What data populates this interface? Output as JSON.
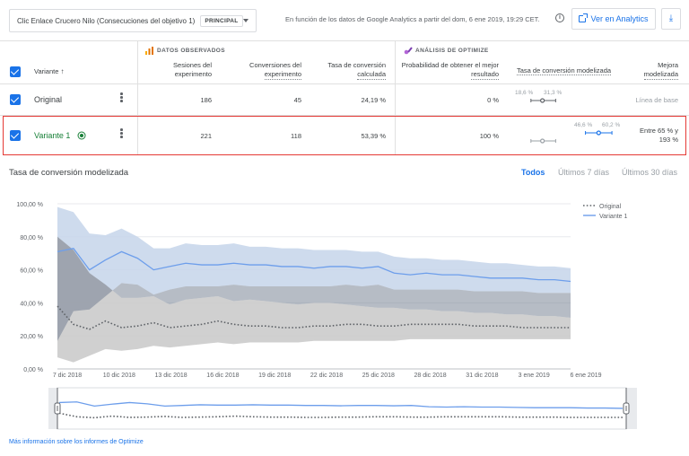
{
  "header": {
    "objective_selector": "Clic Enlace Crucero Nilo (Consecuciones del objetivo 1)",
    "principal_badge": "PRINCIPAL",
    "ga_info": "En función de los datos de Google Analytics a partir del dom, 6 ene 2019, 19:29 CET.",
    "info_icon_glyph": "i",
    "analytics_button": "Ver en Analytics",
    "download_glyph": "⤓"
  },
  "table": {
    "group_observed": "DATOS OBSERVADOS",
    "group_optimize": "ANÁLISIS DE OPTIMIZE",
    "col_variant": "Variante",
    "col_sessions": [
      "Sesiones del",
      "experimento"
    ],
    "col_conversions": [
      "Conversiones del",
      "experimento"
    ],
    "col_rate": [
      "Tasa de conversión",
      "calculada"
    ],
    "col_probability": [
      "Probabilidad de obtener el mejor",
      "resultado"
    ],
    "col_modeled": "Tasa de conversión modelizada",
    "col_improvement": [
      "Mejora",
      "modelizada"
    ],
    "rows": [
      {
        "name": "Original",
        "sessions": "186",
        "conversions": "45",
        "rate": "24,19 %",
        "probability": "0 %",
        "ci_low": "18,6 %",
        "ci_high": "31,3 %",
        "improvement": "Línea de base",
        "ci_low_value": 18.6,
        "ci_high_value": 31.3,
        "ci_mid_value": 24.5
      },
      {
        "name": "Variante 1",
        "sessions": "221",
        "conversions": "118",
        "rate": "53,39 %",
        "probability": "100 %",
        "ci_low": "46,6 %",
        "ci_high": "60,2 %",
        "improvement": [
          "Entre 65 % y",
          "193 %"
        ],
        "ci_low_value": 46.6,
        "ci_high_value": 60.2,
        "ci_mid_value": 53.4
      }
    ]
  },
  "chart": {
    "title": "Tasa de conversión modelizada",
    "ranges": [
      "Todos",
      "Últimos 7 días",
      "Últimos 30 días"
    ],
    "active_range": "Todos",
    "footer_link": "Más información sobre los informes de Optimize",
    "colors": {
      "variant": "#6d9eeb",
      "variant_band": "#c6d5ea",
      "original": "#5f6368",
      "original_band": "#c8c8c8",
      "accent": "#1a73e8",
      "selected_border": "#e53935"
    }
  },
  "chart_data": {
    "type": "line",
    "title": "Tasa de conversión modelizada",
    "ylim": [
      0,
      100
    ],
    "yticks": [
      "0,00 %",
      "20,00 %",
      "40,00 %",
      "60,00 %",
      "80,00 %",
      "100,00 %"
    ],
    "xticks": [
      "7 dic 2018",
      "10 dic 2018",
      "13 dic 2018",
      "16 dic 2018",
      "19 dic 2018",
      "22 dic 2018",
      "25 dic 2018",
      "28 dic 2018",
      "31 dic 2018",
      "3 ene 2019",
      "6 ene 2019"
    ],
    "legend_position": "top-right",
    "series": [
      {
        "name": "Original",
        "style": "dotted",
        "values": [
          38,
          27,
          24,
          29,
          25,
          26,
          28,
          25,
          26,
          27,
          29,
          27,
          26,
          26,
          25,
          25,
          26,
          26,
          27,
          27,
          26,
          26,
          27,
          27,
          27,
          27,
          26,
          26,
          26,
          25,
          25,
          25,
          25
        ],
        "upper": [
          80,
          72,
          58,
          51,
          43,
          43,
          44,
          39,
          42,
          43,
          44,
          41,
          42,
          41,
          40,
          39,
          40,
          40,
          39,
          38,
          37,
          37,
          36,
          36,
          35,
          35,
          34,
          34,
          33,
          33,
          32,
          32,
          31
        ],
        "lower": [
          7,
          4,
          8,
          12,
          11,
          12,
          14,
          13,
          14,
          15,
          16,
          15,
          16,
          16,
          16,
          16,
          17,
          17,
          17,
          17,
          17,
          17,
          18,
          18,
          18,
          18,
          18,
          18,
          18,
          18,
          18,
          18,
          18
        ]
      },
      {
        "name": "Variante 1",
        "style": "solid",
        "values": [
          71,
          73,
          60,
          66,
          71,
          67,
          60,
          62,
          64,
          63,
          63,
          64,
          63,
          63,
          62,
          62,
          61,
          62,
          62,
          61,
          62,
          58,
          57,
          58,
          57,
          57,
          56,
          55,
          55,
          55,
          54,
          54,
          53
        ],
        "upper": [
          98,
          95,
          82,
          81,
          85,
          80,
          73,
          73,
          76,
          75,
          75,
          76,
          74,
          74,
          73,
          73,
          72,
          72,
          72,
          71,
          71,
          68,
          67,
          67,
          66,
          66,
          65,
          64,
          64,
          63,
          62,
          62,
          61
        ],
        "lower": [
          17,
          35,
          36,
          44,
          52,
          51,
          45,
          48,
          50,
          50,
          50,
          51,
          50,
          50,
          50,
          50,
          50,
          50,
          51,
          50,
          51,
          48,
          48,
          48,
          48,
          48,
          47,
          47,
          47,
          47,
          46,
          46,
          46
        ]
      }
    ]
  }
}
